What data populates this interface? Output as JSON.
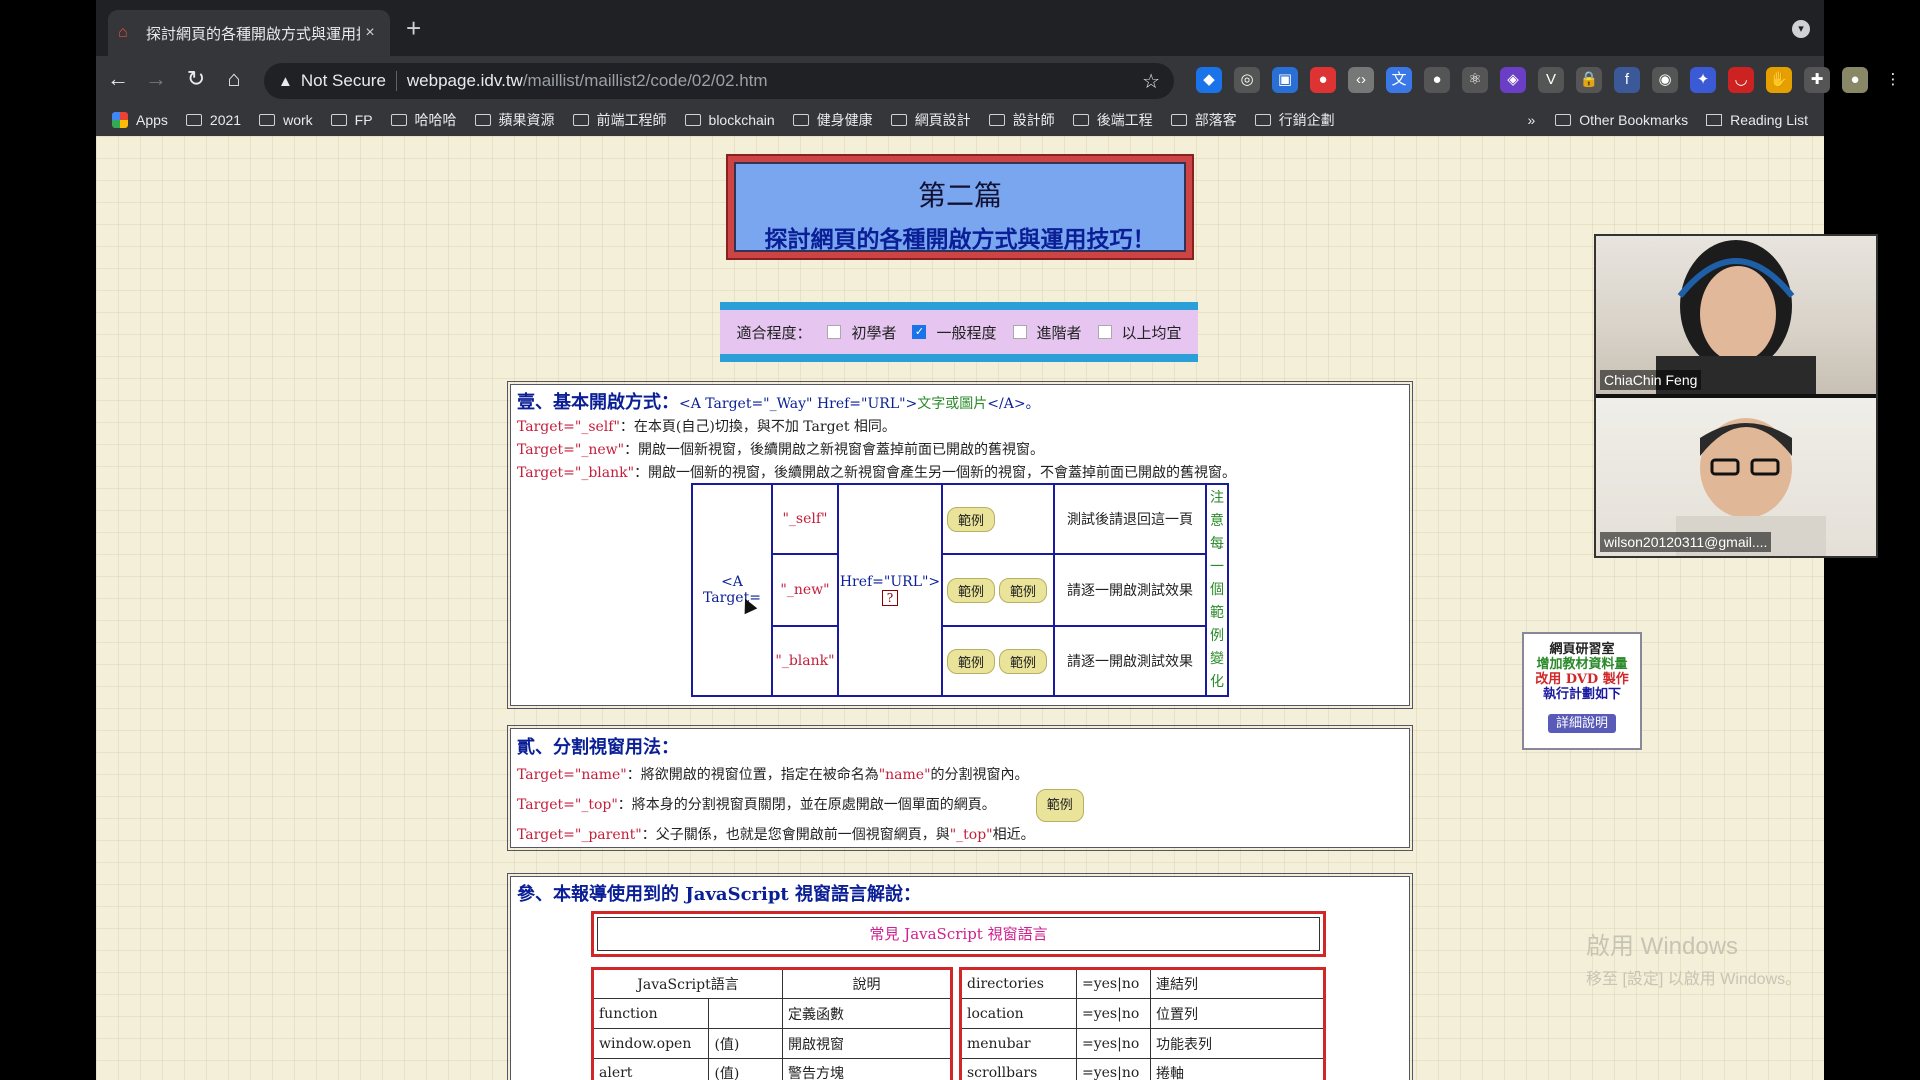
{
  "tab": {
    "title": "探討網頁的各種開啟方式與運用技",
    "close": "×",
    "new": "+"
  },
  "nav": {
    "back": "←",
    "forward": "→",
    "reload": "↻",
    "home": "⌂"
  },
  "omnibox": {
    "warning": "▲",
    "security": "Not Secure",
    "host": "webpage.idv.tw",
    "path": "/maillist/maillist2/code/02/02.htm",
    "star": "☆"
  },
  "bookmarks": {
    "apps": "Apps",
    "folders": [
      "2021",
      "work",
      "FP",
      "哈哈哈",
      "蘋果資源",
      "前端工程師",
      "blockchain",
      "健身健康",
      "網頁設計",
      "設計師",
      "後端工程",
      "部落客",
      "行銷企劃"
    ],
    "more": "»",
    "other": "Other Bookmarks",
    "reading": "Reading List"
  },
  "page": {
    "title_line1": "第二篇",
    "title_line2": "探討網頁的各種開啟方式與運用技巧！",
    "level": {
      "label": "適合程度：",
      "options": [
        "初學者",
        "一般程度",
        "進階者",
        "以上均宜"
      ],
      "checked": "一般程度"
    },
    "s1": {
      "heading": "壹、基本開啟方式：",
      "syntax_a": "<A Target=\"_Way\" Href=\"URL\">",
      "syntax_text": "文字或圖片",
      "syntax_end": "</A>。",
      "l1_key": "Target=\"_self\"",
      "l1_text": "：在本頁(自己)切換，與不加 Target 相同。",
      "l2_key": "Target=\"_new\"",
      "l2_text": "：開啟一個新視窗，後續開啟之新視窗會蓋掉前面已開啟的舊視窗。",
      "l3_key": "Target=\"_blank\"",
      "l3_text": "：開啟一個新的視窗，後續開啟之新視窗會產生另一個新的視窗，不會蓋掉前面已開啟的舊視窗。",
      "table": {
        "a_target": "<A Target=",
        "self": "\"_self\"",
        "new": "\"_new\"",
        "blank": "\"_blank\"",
        "href": "Href=\"URL\">",
        "qm": "?",
        "ex": "範例",
        "desc_self": "測試後請退回這一頁",
        "desc_new": "請逐一開啟測試效果",
        "desc_blank": "請逐一開啟測試效果",
        "note": "注意每一個範例變化"
      }
    },
    "s2": {
      "heading": "貳、分割視窗用法：",
      "l1_key": "Target=\"name\"",
      "l1_text": "：將欲開啟的視窗位置，指定在被命名為",
      "l1_name": "\"name\"",
      "l1_end": "的分割視窗內。",
      "l2_key": "Target=\"_top\"",
      "l2_text": "：將本身的分割視窗頁關閉，並在原處開啟一個單面的網頁。",
      "l3_key": "Target=\"_parent\"",
      "l3_text": "：父子關係，也就是您會開啟前一個視窗網頁，與",
      "l3_top": "\"_top\"",
      "l3_end": "相近。",
      "ex": "範例"
    },
    "s3": {
      "heading": "參、本報導使用到的 JavaScript 視窗語言解說：",
      "table_title": "常見 JavaScript 視窗語言",
      "left_headers": [
        "JavaScript語言",
        "說明"
      ],
      "left_rows": [
        [
          "function",
          "",
          "定義函數"
        ],
        [
          "window.open",
          "(值)",
          "開啟視窗"
        ],
        [
          "alert",
          "(值)",
          "警告方塊"
        ]
      ],
      "right_rows": [
        [
          "directories",
          "=yes|no",
          "連結列"
        ],
        [
          "location",
          "=yes|no",
          "位置列"
        ],
        [
          "menubar",
          "=yes|no",
          "功能表列"
        ],
        [
          "scrollbars",
          "=yes|no",
          "捲軸"
        ]
      ]
    },
    "sidebox": {
      "l1": "網頁研習室",
      "l2": "增加教材資料量",
      "l3": "改用 DVD 製作",
      "l4": "執行計劃如下",
      "btn": "詳細說明"
    },
    "watermark": {
      "l1": "啟用 Windows",
      "l2": "移至 [設定] 以啟用 Windows。"
    }
  },
  "video": {
    "p1": "ChiaChin Feng",
    "p2": "wilson20120311@gmail...."
  }
}
